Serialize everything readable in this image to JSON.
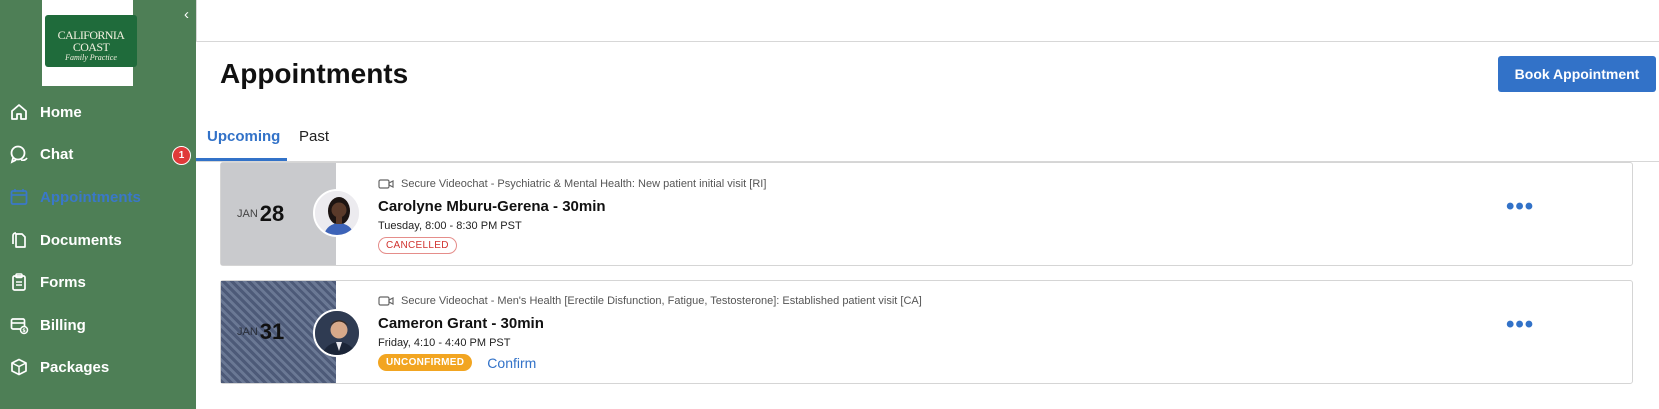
{
  "logo": {
    "line1": "CALIFORNIA COAST",
    "line2": "Family Practice"
  },
  "sidebar": {
    "items": [
      {
        "label": "Home",
        "icon": "home-icon"
      },
      {
        "label": "Chat",
        "icon": "chat-icon",
        "badge": "1"
      },
      {
        "label": "Appointments",
        "icon": "calendar-icon",
        "active": true
      },
      {
        "label": "Documents",
        "icon": "documents-icon"
      },
      {
        "label": "Forms",
        "icon": "clipboard-icon"
      },
      {
        "label": "Billing",
        "icon": "billing-icon"
      },
      {
        "label": "Packages",
        "icon": "package-icon"
      }
    ]
  },
  "header": {
    "title": "Appointments",
    "book_label": "Book Appointment"
  },
  "tabs": [
    {
      "label": "Upcoming",
      "active": true
    },
    {
      "label": "Past",
      "active": false
    }
  ],
  "appointments": [
    {
      "month": "JAN",
      "day": "28",
      "visit_type": "Secure Videochat - Psychiatric & Mental Health: New patient initial visit [RI]",
      "provider": "Carolyne Mburu-Gerena - 30min",
      "time": "Tuesday, 8:00 - 8:30 PM PST",
      "status": "CANCELLED"
    },
    {
      "month": "JAN",
      "day": "31",
      "visit_type": "Secure Videochat - Men's Health [Erectile Disfunction, Fatigue, Testosterone]: Established patient visit [CA]",
      "provider": "Cameron Grant - 30min",
      "time": "Friday, 4:10 - 4:40 PM PST",
      "status": "UNCONFIRMED",
      "action": "Confirm"
    }
  ],
  "more_label": "•••",
  "colors": {
    "sidebar": "#4e7f56",
    "accent": "#3272c8",
    "cancelled": "#d0332f",
    "unconfirmed": "#f2a521"
  }
}
